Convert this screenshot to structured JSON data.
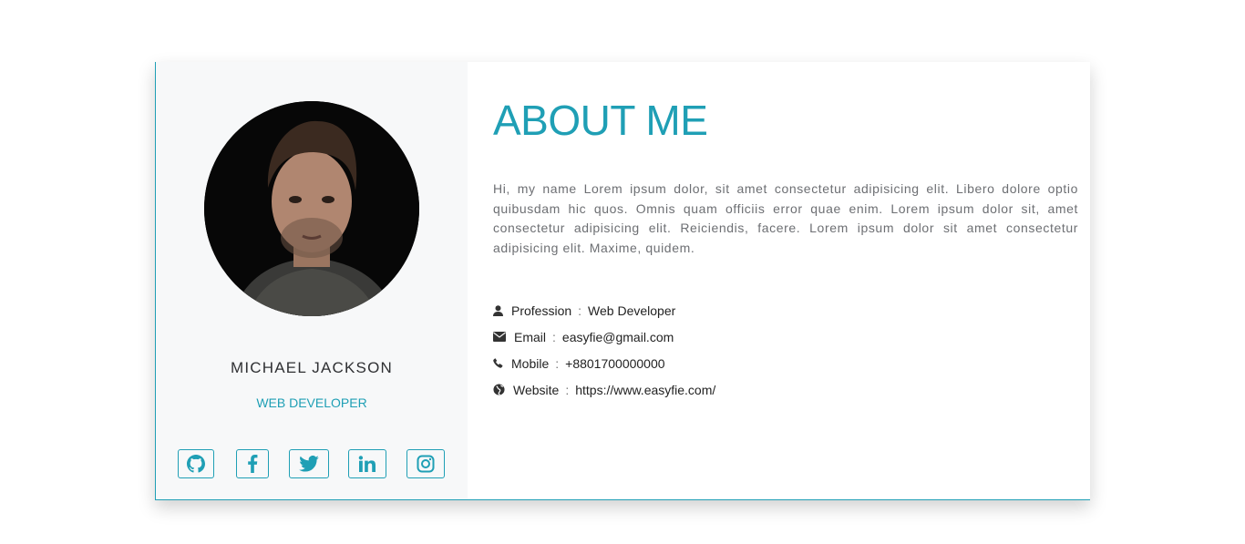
{
  "profile": {
    "name": "MICHAEL JACKSON",
    "role": "WEB DEVELOPER",
    "photo_alt": "profile photo"
  },
  "social": [
    {
      "icon": "github-icon"
    },
    {
      "icon": "facebook-icon"
    },
    {
      "icon": "twitter-icon"
    },
    {
      "icon": "linkedin-icon"
    },
    {
      "icon": "instagram-icon"
    }
  ],
  "about": {
    "title": "ABOUT ME",
    "bio": "Hi, my name Lorem ipsum dolor, sit amet consectetur adipisicing elit. Libero dolore optio quibusdam hic quos. Omnis quam officiis error quae enim. Lorem ipsum dolor sit, amet consectetur adipisicing elit. Reiciendis, facere. Lorem ipsum dolor sit amet consectetur adipisicing elit. Maxime, quidem."
  },
  "info": [
    {
      "icon": "user-icon",
      "label": "Profession",
      "sep": ":",
      "value": "Web Developer"
    },
    {
      "icon": "envelope-icon",
      "label": "Email",
      "sep": ":",
      "value": "easyfie@gmail.com"
    },
    {
      "icon": "phone-icon",
      "label": "Mobile",
      "sep": ":",
      "value": "+8801700000000"
    },
    {
      "icon": "globe-icon",
      "label": "Website",
      "sep": ":",
      "value": "https://www.easyfie.com/"
    }
  ],
  "colors": {
    "accent": "#1f9fb5",
    "left_panel": "#f7f8f9",
    "text_dark": "#2f3033",
    "text_muted": "#6d6f73"
  }
}
